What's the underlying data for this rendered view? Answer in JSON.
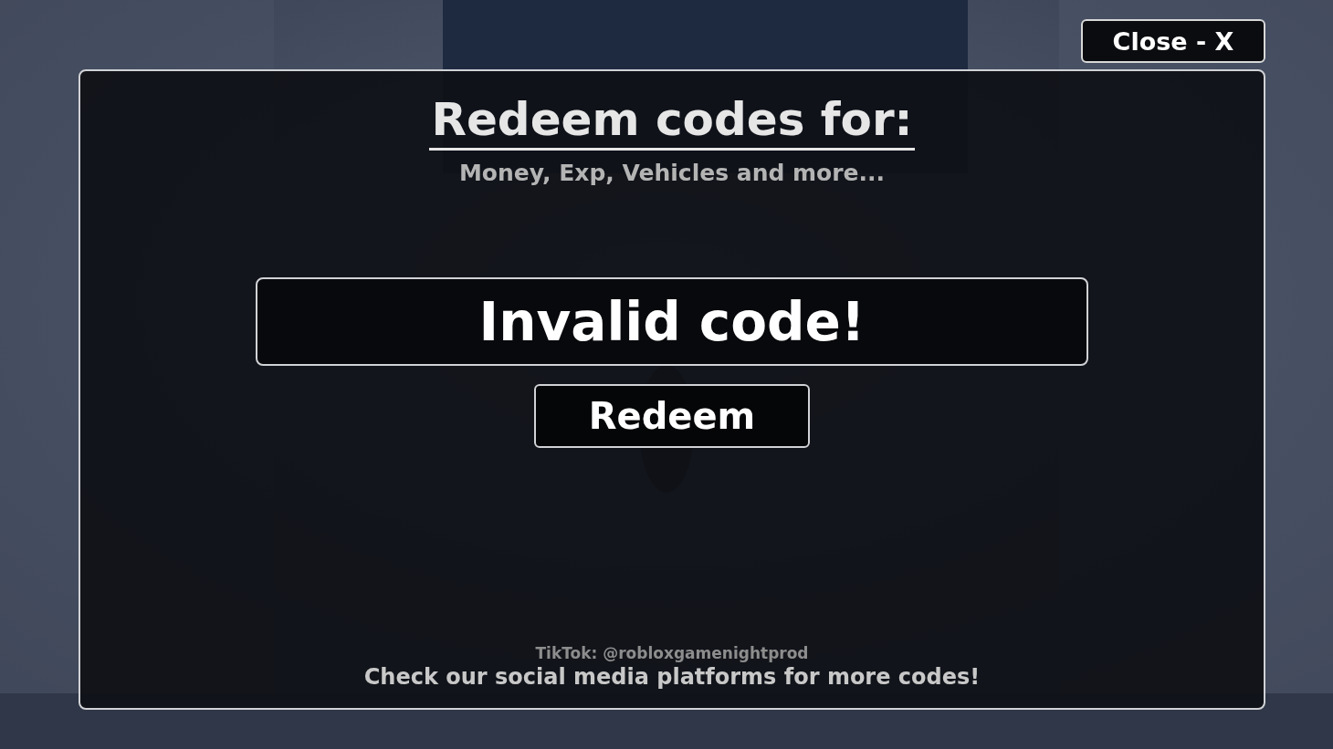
{
  "close_button": {
    "label": "Close - X"
  },
  "panel": {
    "title": "Redeem codes for:",
    "subtitle": "Money, Exp, Vehicles and more...",
    "code_field": {
      "value": "Invalid code!"
    },
    "redeem_button": {
      "label": "Redeem"
    },
    "tiktok": "TikTok: @robloxgamenightprod",
    "footer": "Check our social media platforms for more codes!"
  }
}
